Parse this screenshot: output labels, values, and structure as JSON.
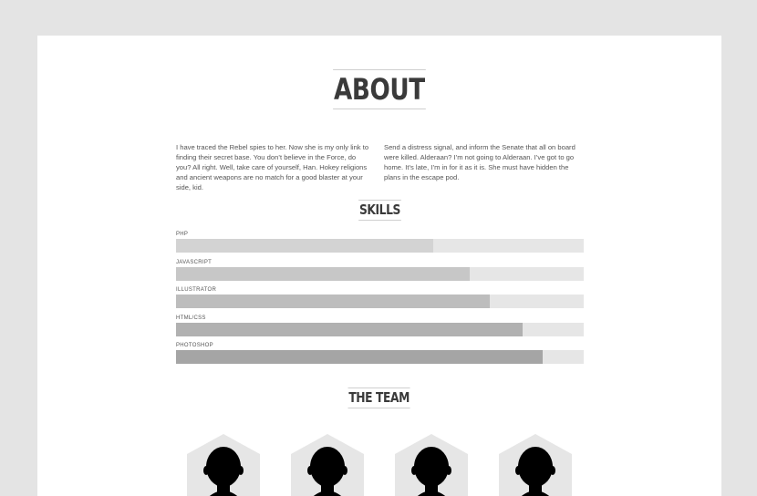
{
  "about": {
    "title": "ABOUT",
    "left_text": "I have traced the Rebel spies to her. Now she is my only link to finding their secret base. You don’t believe in the Force, do you? All right. Well, take care of yourself, Han. Hokey religions and ancient weapons are no match for a good blaster at your side, kid.",
    "right_text": "Send a distress signal, and inform the Senate that all on board were killed. Alderaan? I’m not going to Alderaan. I’ve got to go home. It’s late, I’m in for it as it is. She must have hidden the plans in the escape pod."
  },
  "skills": {
    "title": "SKILLS",
    "items": [
      {
        "label": "PHP",
        "level": 0.63,
        "color": "#d3d3d3"
      },
      {
        "label": "JAVASCRIPT",
        "level": 0.72,
        "color": "#c7c7c7"
      },
      {
        "label": "ILLUSTRATOR",
        "level": 0.77,
        "color": "#bdbdbd"
      },
      {
        "label": "HTML/CSS",
        "level": 0.85,
        "color": "#b1b1b1"
      },
      {
        "label": "PHOTOSHOP",
        "level": 0.9,
        "color": "#a5a5a5"
      }
    ]
  },
  "team": {
    "title": "THE TEAM",
    "members": [
      {
        "icon": "person-silhouette-icon"
      },
      {
        "icon": "person-silhouette-icon"
      },
      {
        "icon": "person-silhouette-icon"
      },
      {
        "icon": "person-silhouette-icon"
      }
    ]
  }
}
